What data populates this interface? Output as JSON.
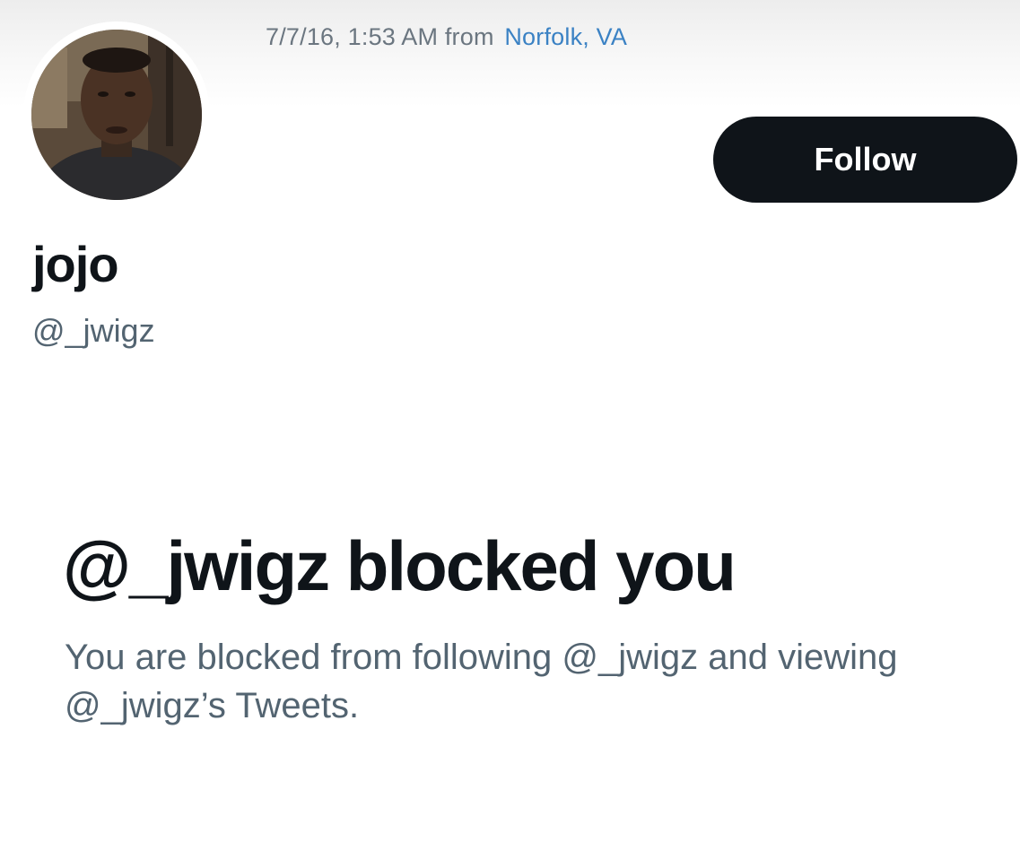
{
  "tweet_meta": {
    "timestamp": "7/7/16, 1:53 AM from",
    "location": "Norfolk, VA"
  },
  "profile": {
    "display_name": "jojo",
    "handle": "@_jwigz",
    "avatar_icon": "avatar-photo-icon"
  },
  "actions": {
    "follow_label": "Follow"
  },
  "blocked_notice": {
    "title": "@_jwigz blocked you",
    "description": "You are blocked from following @_jwigz and viewing @_jwigz’s Tweets."
  },
  "colors": {
    "primary_text": "#0f1419",
    "secondary_text": "#536471",
    "link": "#3b82c4",
    "button_bg": "#0f1419",
    "button_text": "#ffffff"
  }
}
